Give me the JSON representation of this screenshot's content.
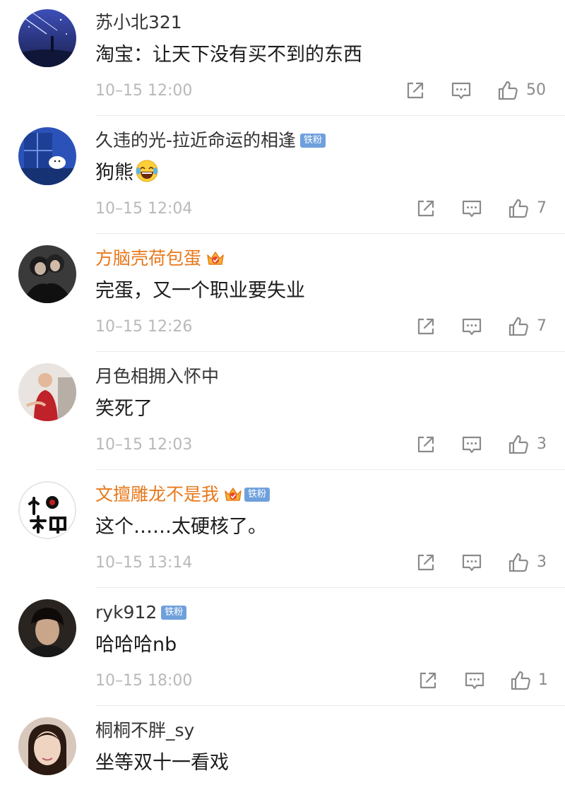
{
  "comments": [
    {
      "username": "苏小北321",
      "vip": false,
      "badge": "",
      "text": "淘宝：让天下没有买不到的东西",
      "emoji": "",
      "time": "10–15 12:00",
      "likes": "50",
      "avatar": "anime-night-sky-avatar"
    },
    {
      "username": "久违的光-拉近命运的相逢",
      "vip": false,
      "badge": "铁粉",
      "text": "狗熊",
      "emoji": "laughing-tears-emoji",
      "time": "10–15 12:04",
      "likes": "7",
      "avatar": "blue-window-avatar"
    },
    {
      "username": "方脑壳荷包蛋",
      "vip": true,
      "badge": "",
      "text": "完蛋，又一个职业要失业",
      "emoji": "",
      "time": "10–15 12:26",
      "likes": "7",
      "avatar": "dark-couple-avatar"
    },
    {
      "username": "月色相拥入怀中",
      "vip": false,
      "badge": "",
      "text": "笑死了",
      "emoji": "",
      "time": "10–15 12:03",
      "likes": "3",
      "avatar": "red-dress-avatar"
    },
    {
      "username": "文擅雕龙不是我",
      "vip": true,
      "badge": "铁粉",
      "text": "这个……太硬核了。",
      "emoji": "",
      "time": "10–15 13:14",
      "likes": "3",
      "avatar": "calligraphy-avatar"
    },
    {
      "username": "ryk912",
      "vip": false,
      "badge": "铁粉",
      "text": "哈哈哈nb",
      "emoji": "",
      "time": "10–15 18:00",
      "likes": "1",
      "avatar": "dark-portrait-avatar"
    },
    {
      "username": "桐桐不胖_sy",
      "vip": false,
      "badge": "",
      "text": "坐等双十一看戏",
      "emoji": "",
      "time": "",
      "likes": "",
      "avatar": "girl-selfie-avatar"
    }
  ],
  "colors": {
    "vip_name": "#e8791c",
    "name": "#333333",
    "badge": "#6fa0dc",
    "meta": "#b9b9b9",
    "icon": "#8a8a8a"
  }
}
